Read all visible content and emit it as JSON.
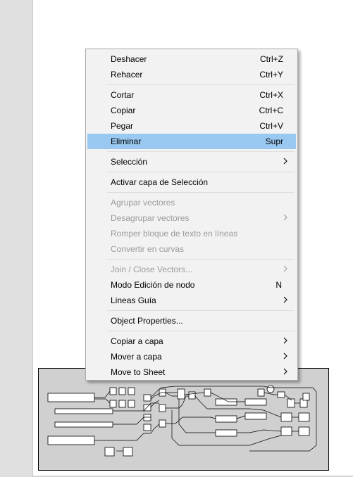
{
  "menu": {
    "undo": {
      "label": "Deshacer",
      "shortcut": "Ctrl+Z"
    },
    "redo": {
      "label": "Rehacer",
      "shortcut": "Ctrl+Y"
    },
    "cut": {
      "label": "Cortar",
      "shortcut": "Ctrl+X"
    },
    "copy": {
      "label": "Copiar",
      "shortcut": "Ctrl+C"
    },
    "paste": {
      "label": "Pegar",
      "shortcut": "Ctrl+V"
    },
    "delete": {
      "label": "Eliminar",
      "shortcut": "Supr"
    },
    "selection": {
      "label": "Selección"
    },
    "activate_selection_layer": {
      "label": "Activar capa de Selección"
    },
    "group_vectors": {
      "label": "Agrupar vectores"
    },
    "ungroup_vectors": {
      "label": "Desagrupar vectores"
    },
    "break_text": {
      "label": "Romper bloque de texto en líneas"
    },
    "convert_curves": {
      "label": "Convertir en curvas"
    },
    "join_close": {
      "label": "Join / Close Vectors..."
    },
    "node_edit": {
      "label": "Modo Edición de nodo",
      "shortcut": "N"
    },
    "guide_lines": {
      "label": "Lineas Guía"
    },
    "object_properties": {
      "label": "Object Properties..."
    },
    "copy_to_layer": {
      "label": "Copiar a capa"
    },
    "move_to_layer": {
      "label": "Mover a capa"
    },
    "move_to_sheet": {
      "label": "Move to Sheet"
    }
  },
  "colors": {
    "highlight": "#99c9f0",
    "disabled_text": "#9b9b9b",
    "pcb_background": "#d0d0d0",
    "trace": "#ffffff"
  }
}
